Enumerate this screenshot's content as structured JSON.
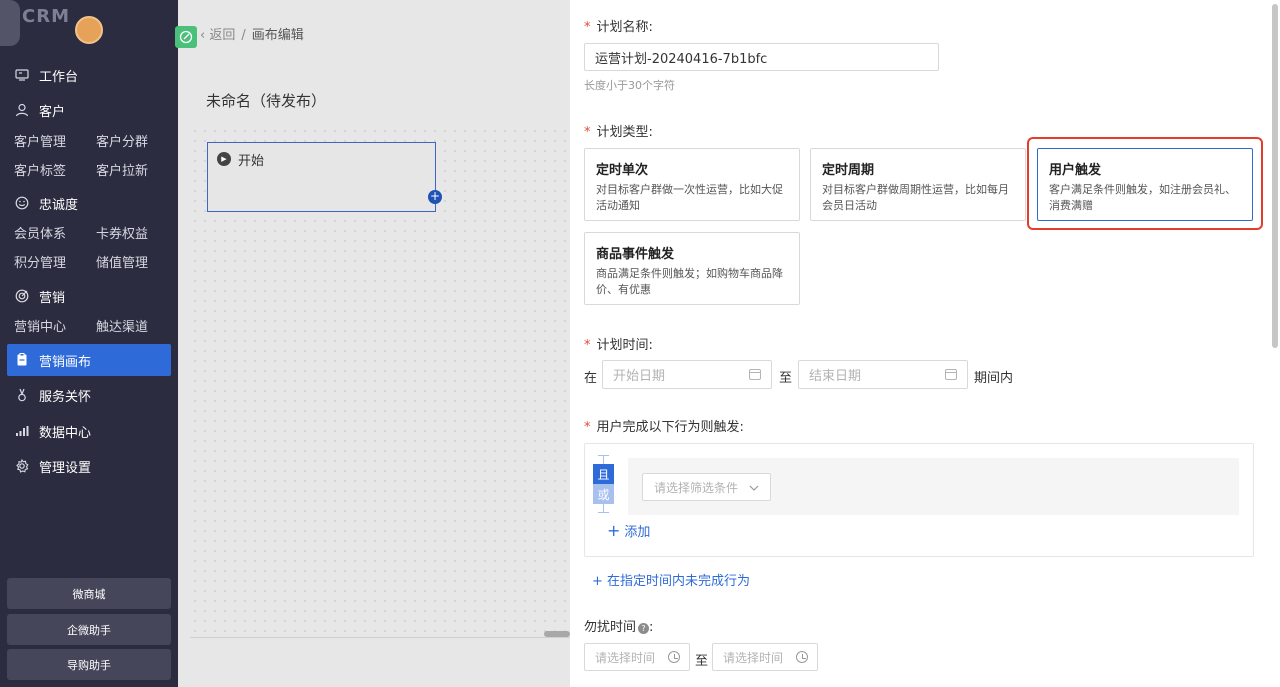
{
  "sidebar": {
    "brand": "CRM",
    "groups": [
      {
        "label": "工作台",
        "icon": "workbench-icon"
      },
      {
        "label": "客户",
        "icon": "user-icon",
        "subs": [
          "客户管理",
          "客户分群",
          "客户标签",
          "客户拉新"
        ]
      },
      {
        "label": "忠诚度",
        "icon": "smile-icon",
        "subs": [
          "会员体系",
          "卡券权益",
          "积分管理",
          "储值管理"
        ]
      },
      {
        "label": "营销",
        "icon": "target-icon",
        "subs": [
          "营销中心",
          "触达渠道"
        ]
      },
      {
        "label": "营销画布",
        "icon": "canvas-icon",
        "active": true
      },
      {
        "label": "服务关怀",
        "icon": "service-icon"
      },
      {
        "label": "数据中心",
        "icon": "chart-icon"
      },
      {
        "label": "管理设置",
        "icon": "gear-icon"
      }
    ],
    "bottom_buttons": [
      "微商城",
      "企微助手",
      "导购助手"
    ]
  },
  "canvas": {
    "breadcrumb_back": "返回",
    "breadcrumb_sep": "/",
    "breadcrumb_current": "画布编辑",
    "title": "未命名（待发布）",
    "start_node_label": "开始"
  },
  "form": {
    "plan_name_label": "计划名称:",
    "plan_name_value": "运营计划-20240416-7b1bfc",
    "plan_name_hint": "长度小于30个字符",
    "plan_type_label": "计划类型:",
    "plan_types": [
      {
        "title": "定时单次",
        "desc": "对目标客户群做一次性运营，比如大促活动通知"
      },
      {
        "title": "定时周期",
        "desc": "对目标客户群做周期性运营，比如每月会员日活动"
      },
      {
        "title": "用户触发",
        "desc": "客户满足条件则触发，如注册会员礼、消费满赠",
        "selected": true
      },
      {
        "title": "商品事件触发",
        "desc": "商品满足条件则触发；如购物车商品降价、有优惠"
      }
    ],
    "plan_time_label": "计划时间:",
    "time_prefix": "在",
    "start_date_placeholder": "开始日期",
    "to_text": "至",
    "end_date_placeholder": "结束日期",
    "time_suffix": "期间内",
    "trigger_label": "用户完成以下行为则触发:",
    "and_label": "且",
    "or_label": "或",
    "filter_placeholder": "请选择筛选条件",
    "add_label": "添加",
    "not_done_link": "+ 在指定时间内未完成行为",
    "dnd_label": "勿扰时间",
    "dnd_start_placeholder": "请选择时间",
    "dnd_to": "至",
    "dnd_end_placeholder": "请选择时间"
  }
}
